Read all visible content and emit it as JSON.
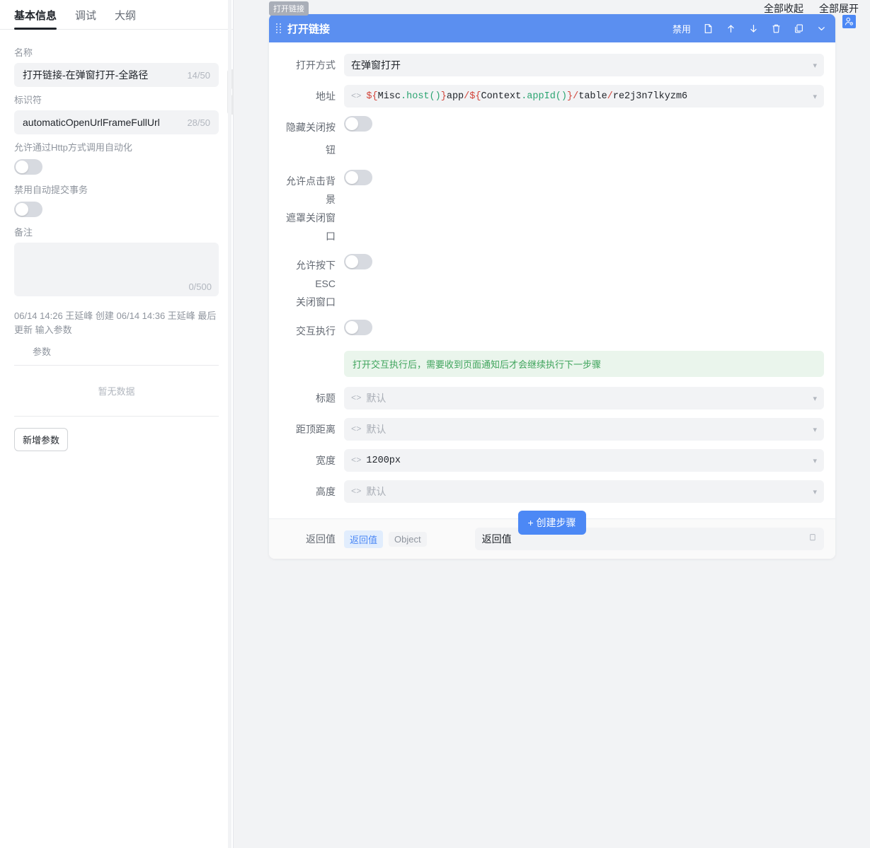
{
  "sidebar": {
    "tabs": [
      {
        "label": "基本信息",
        "active": true
      },
      {
        "label": "调试",
        "active": false
      },
      {
        "label": "大纲",
        "active": false
      }
    ],
    "name": {
      "label": "名称",
      "value": "打开链接-在弹窗打开-全路径",
      "count": "14/50"
    },
    "identifier": {
      "label": "标识符",
      "value": "automaticOpenUrlFrameFullUrl",
      "count": "28/50"
    },
    "http_toggle": {
      "label": "允许通过Http方式调用自动化",
      "on": false
    },
    "disable_auto_commit": {
      "label": "禁用自动提交事务",
      "on": false
    },
    "remark": {
      "label": "备注",
      "value": "",
      "count": "0/500"
    },
    "meta": "06/14 14:26 王延峰 创建 06/14 14:36 王延峰 最后更新",
    "input_params_title": "输入参数",
    "param_column": "参数",
    "empty_text": "暂无数据",
    "add_param_button": "新增参数"
  },
  "topbar": {
    "collapse_all": "全部收起",
    "expand_all": "全部展开"
  },
  "card": {
    "tag": "打开链接",
    "title": "打开链接",
    "disable_label": "禁用",
    "rows": [
      {
        "label": "打开方式",
        "type": "select",
        "value": "在弹窗打开"
      },
      {
        "label": "地址",
        "type": "code",
        "value": "${Misc.host()}app/${Context.appId()}/table/re2j3n7lkyzm6"
      },
      {
        "label": "隐藏关闭按钮",
        "type": "switch",
        "on": false
      },
      {
        "label": "允许点击背景",
        "label2": "遮罩关闭窗口",
        "type": "switch",
        "on": false
      },
      {
        "label": "允许按下 ESC",
        "label2": "关闭窗口",
        "type": "switch",
        "on": false
      },
      {
        "label": "交互执行",
        "type": "switch",
        "on": false
      }
    ],
    "alert": "打开交互执行后，需要收到页面通知后才会继续执行下一步骤",
    "fields": [
      {
        "label": "标题",
        "value": "",
        "placeholder": "默认"
      },
      {
        "label": "距顶距离",
        "value": "",
        "placeholder": "默认"
      },
      {
        "label": "宽度",
        "value": "1200px",
        "placeholder": "默认"
      },
      {
        "label": "高度",
        "value": "",
        "placeholder": "默认"
      }
    ],
    "footer": {
      "label": "返回值",
      "pill_value": "返回值",
      "pill_type": "Object",
      "input_value": "返回值"
    }
  },
  "create_step_button": "+ 创建步骤",
  "colors": {
    "accent": "#4c88f5",
    "card_header": "#5b8ff0",
    "alert_text": "#3fa45c",
    "alert_bg": "#eaf5ec"
  }
}
